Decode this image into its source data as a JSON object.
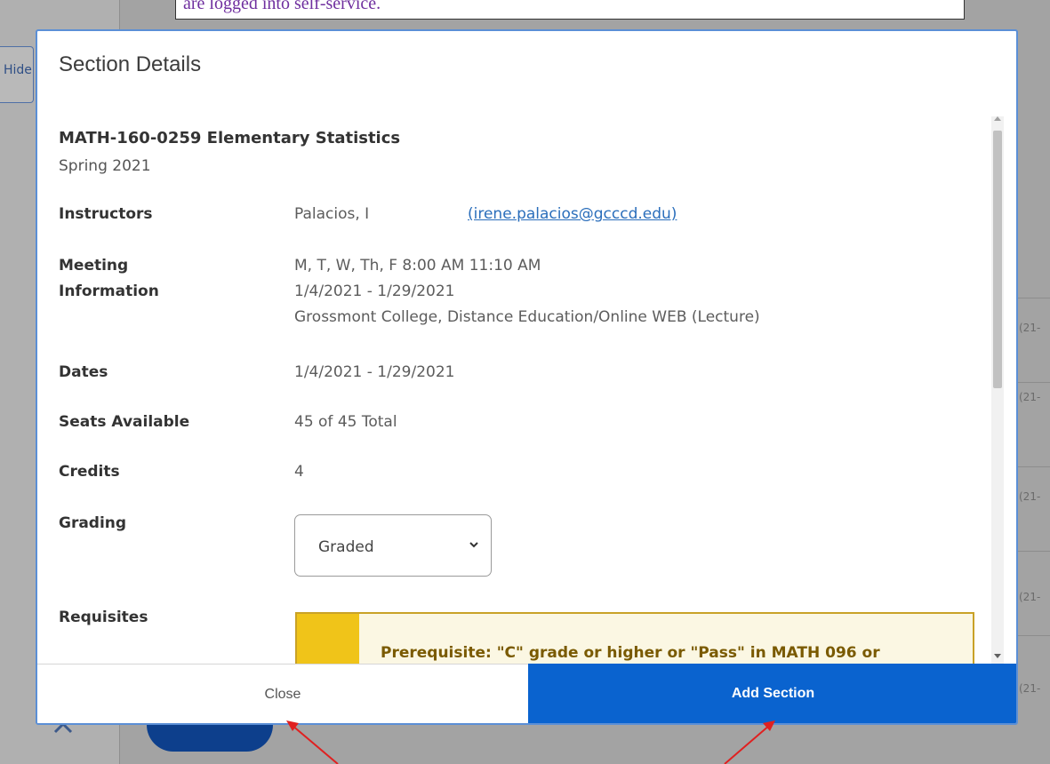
{
  "note": {
    "text": "are logged into self-service."
  },
  "background": {
    "hide_button_label": "Hide",
    "row_dates": [
      "(21-",
      "(21-",
      "(21-",
      "(21-",
      "(21-"
    ]
  },
  "modal": {
    "title": "Section Details",
    "course_title": "MATH-160-0259 Elementary Statistics",
    "term": "Spring 2021",
    "instructors_label": "Instructors",
    "instructor_name": "Palacios, I",
    "instructor_email": "(irene.palacios@gcccd.edu)",
    "meeting_label_line1": "Meeting",
    "meeting_label_line2": "Information",
    "meeting_days": "M, T, W, Th, F 8:00 AM 11:10 AM",
    "meeting_dates": "1/4/2021 - 1/29/2021",
    "meeting_location": "Grossmont College, Distance Education/Online WEB (Lecture)",
    "dates_label": "Dates",
    "dates_value": "1/4/2021 - 1/29/2021",
    "seats_label": "Seats Available",
    "seats_value": "45 of 45 Total",
    "credits_label": "Credits",
    "credits_value": "4",
    "grading_label": "Grading",
    "grading_value": "Graded",
    "requisites_label": "Requisites",
    "requisite_text": "Prerequisite: \"C\" grade or higher or \"Pass\" in MATH 096 or",
    "close_label": "Close",
    "add_section_label": "Add Section"
  },
  "colors": {
    "accent": "#0a63cf",
    "link": "#2a6ebb",
    "requisite_bar": "#f0c419",
    "annotation_arrow": "#e02020"
  }
}
